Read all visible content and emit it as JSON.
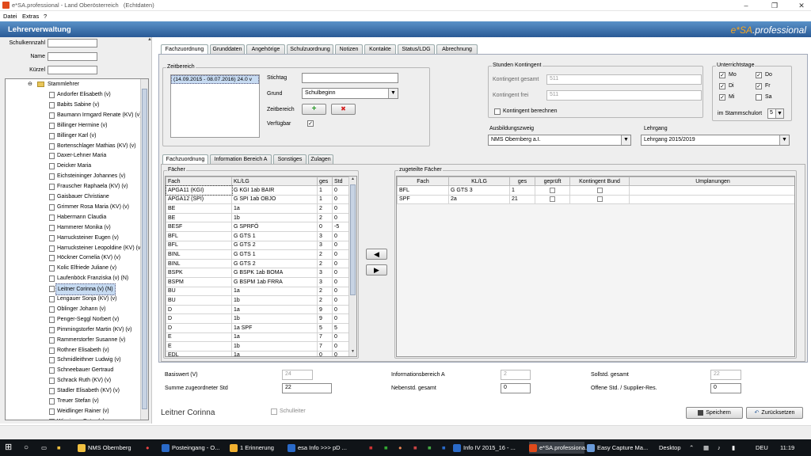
{
  "window": {
    "title": "e*SA.professional - Land Oberösterreich",
    "env": "(Echtdaten)"
  },
  "menu": [
    "Datei",
    "Extras",
    "?"
  ],
  "app": {
    "section_title": "Lehrerverwaltung",
    "brand_prefix": "e*SA",
    "brand_suffix": ".professional"
  },
  "search": {
    "schulkennzahl_label": "Schulkennzahl",
    "name_label": "Name",
    "kuerzel_label": "Kürzel"
  },
  "tree": {
    "root": "Stammlehrer",
    "items": [
      "Andorfer Elisabeth (v)",
      "Babits Sabine (v)",
      "Baumann Irmgard Renate (KV) (v)",
      "Billinger Hermine (v)",
      "Billinger Karl (v)",
      "Bortenschlager Mathias (KV) (v)",
      "Daxer-Lehner Maria",
      "Deicker Maria",
      "Eichsteininger Johannes (v)",
      "Frauscher Raphaela (KV) (v)",
      "Gaisbauer Christiane",
      "Grimmer Rosa Maria (KV) (v)",
      "Habermann Claudia",
      "Hammerer Monika (v)",
      "Harrucksteiner Eugen (v)",
      "Harrucksteiner Leopoldine (KV) (v)",
      "Höckner Cornelia (KV) (v)",
      "Kolic Elfriede Juliane (v)",
      "Laufenböck Franziska (v) (N)",
      "Leitner Corinna (v) (N)",
      "Lengauer Sonja (KV) (v)",
      "Oblinger Johann (v)",
      "Penger-Seggl Norbert (v)",
      "Pimmingstorfer Martin (KV) (v)",
      "Rammerstorfer Susanne (v)",
      "Rothner Elisabeth (v)",
      "Schmidleithner Ludwig (v)",
      "Schneebauer Gertraud",
      "Schrack Ruth (KV) (v)",
      "Stadler Elisabeth (KV) (v)",
      "Treuer Stefan (v)",
      "Weidlinger Rainer (v)",
      "Wiesinger Peter (v)"
    ],
    "selected_index": 19
  },
  "tabs": [
    "Fachzuordnung",
    "Grunddaten",
    "Angehörige",
    "Schulzuordnung",
    "Notizen",
    "Kontakte",
    "Status/LDG",
    "Abrechnung"
  ],
  "zeitbereich": {
    "label": "Zeitbereich",
    "entry": "(14.09.2015 - 08.07.2016) 24.0 v",
    "stichtag_label": "Stichtag",
    "stichtag_value": "",
    "grund_label": "Grund",
    "grund_value": "Schulbeginn",
    "zeitbereich_label": "Zeitbereich",
    "verfuegbar_label": "Verfügbar",
    "add_icon": "+",
    "delete_icon": "✖"
  },
  "stunden": {
    "label": "Stunden Kontingent",
    "gesamt_label": "Kontingent gesamt",
    "gesamt_value": "511",
    "frei_label": "Kontingent frei",
    "frei_value": "511",
    "berechnen_label": "Kontingent berechnen"
  },
  "unterrichtstage": {
    "label": "Unterrichtstage",
    "days": [
      {
        "d": "Mo",
        "on": true
      },
      {
        "d": "Do",
        "on": true
      },
      {
        "d": "Di",
        "on": true
      },
      {
        "d": "Fr",
        "on": true
      },
      {
        "d": "Mi",
        "on": true
      },
      {
        "d": "Sa",
        "on": false
      }
    ],
    "stammschulort_label": "im Stammschulort",
    "stammschulort_value": "5"
  },
  "ausbildungszweig": {
    "label": "Ausbildungszweig",
    "value": "NMS Obernberg a.I."
  },
  "lehrgang": {
    "label": "Lehrgang",
    "value": "Lehrgang 2015/2019"
  },
  "subtabs": [
    "Fachzuordnung",
    "Information Bereich A",
    "Sonstiges",
    "Zulagen"
  ],
  "faecher": {
    "label": "Fächer",
    "headers": [
      "Fach",
      "KL/LG",
      "ges",
      "Std"
    ],
    "rows": [
      [
        "APGA11 (KGI)",
        "G KGI 1ab BAIR",
        "1",
        "0"
      ],
      [
        "APGA12 (SPI)",
        "G SPI 1ab OBJO",
        "1",
        "0"
      ],
      [
        "BE",
        "1a",
        "2",
        "0"
      ],
      [
        "BE",
        "1b",
        "2",
        "0"
      ],
      [
        "BESF",
        "G SPRFÖ",
        "0",
        "-5"
      ],
      [
        "BFL",
        "G GTS 1",
        "3",
        "0"
      ],
      [
        "BFL",
        "G GTS 2",
        "3",
        "0"
      ],
      [
        "BINL",
        "G GTS 1",
        "2",
        "0"
      ],
      [
        "BINL",
        "G GTS 2",
        "2",
        "0"
      ],
      [
        "BSPK",
        "G BSPK 1ab  BOMA",
        "3",
        "0"
      ],
      [
        "BSPM",
        "G BSPM 1ab FRRA",
        "3",
        "0"
      ],
      [
        "BU",
        "1a",
        "2",
        "0"
      ],
      [
        "BU",
        "1b",
        "2",
        "0"
      ],
      [
        "D",
        "1a",
        "9",
        "0"
      ],
      [
        "D",
        "1b",
        "9",
        "0"
      ],
      [
        "D",
        "1a SPF",
        "5",
        "5"
      ],
      [
        "E",
        "1a",
        "7",
        "0"
      ],
      [
        "E",
        "1b",
        "7",
        "0"
      ],
      [
        "EDL",
        "1a",
        "0",
        "0"
      ]
    ]
  },
  "zugeteilt": {
    "label": "zugeteilte Fächer",
    "headers": [
      "Fach",
      "KL/LG",
      "ges",
      "geprüft",
      "Kontingent Bund",
      "Umplanungen"
    ],
    "rows": [
      [
        "BFL",
        "G GTS 3",
        "1",
        "",
        ""
      ],
      [
        "SPF",
        "2a",
        "21",
        "",
        ""
      ]
    ]
  },
  "arrows": {
    "left": "◀",
    "right": "▶"
  },
  "summary": {
    "basiswert_label": "Basiswert (V)",
    "basiswert_value": "24",
    "summe_label": "Summe zugeordneter Std",
    "summe_value": "22",
    "infoA_label": "Informationsbereich A",
    "infoA_value": "2",
    "neben_label": "Nebenstd. gesamt",
    "neben_value": "0",
    "soll_label": "Sollstd. gesamt",
    "soll_value": "22",
    "offene_label": "Offene Std. / Supplier-Res.",
    "offene_value": "0"
  },
  "footer": {
    "teacher_name": "Leitner Corinna",
    "schulleiter_label": "Schulleiter",
    "save_label": "Speichern",
    "reset_label": "Zurücksetzen"
  },
  "taskbar": {
    "items": [
      "NMS Obernberg",
      "Posteingang - O...",
      "1 Erinnerung",
      "esa Info >>> pD ...",
      "Info IV 2015_16 - ...",
      "e*SA.professiona...",
      "Easy Capture Ma..."
    ],
    "desktop": "Desktop",
    "lang": "DEU",
    "time": "11:19"
  }
}
